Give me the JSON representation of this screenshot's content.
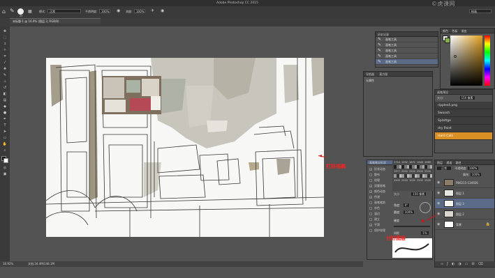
{
  "app": {
    "title": "Adobe Photoshop CC 2015",
    "watermark": "©虎课网"
  },
  "options_bar": {
    "brush_size": "25",
    "mode_label": "模式:",
    "mode_value": "正常",
    "opacity_label": "不透明度:",
    "opacity_value": "100%",
    "flow_label": "流量:",
    "flow_value": "100%",
    "workspace": "绘画"
  },
  "document": {
    "tab": "未标题-1 @ 16.9% (图层 3, RGB/8)"
  },
  "status": {
    "zoom": "16.92%",
    "doc_info": "文档:34.4M/148.1M"
  },
  "history_panel": {
    "title": "历史记录",
    "items": [
      "画笔工具",
      "画笔工具",
      "画笔工具",
      "画笔工具",
      "画笔工具"
    ]
  },
  "navigator_panel": {
    "tabs": [
      "导航器",
      "直方图"
    ],
    "label": "无属性"
  },
  "color_panel": {
    "tabs": [
      "颜色",
      "色板",
      "渐变"
    ]
  },
  "brush_presets_panel": {
    "title": "画笔预设",
    "size_label": "大小:",
    "size_value": "150 像素",
    "brushes": [
      "ripples4.png",
      "Swoosh",
      "Splattge",
      "dry Paint",
      "Hard Calli"
    ],
    "sizes": [
      "1714",
      "1592",
      "1671",
      "1946",
      "1969",
      "1977",
      "2000",
      "2500",
      "2500",
      "2500",
      "2500",
      "2500",
      "1000",
      "2500",
      "2500"
    ]
  },
  "brush_settings": {
    "title": "画笔笔尖形状",
    "items": [
      {
        "label": "形状动态",
        "checked": true
      },
      {
        "label": "散布",
        "checked": false
      },
      {
        "label": "纹理",
        "checked": false
      },
      {
        "label": "双重画笔",
        "checked": true
      },
      {
        "label": "颜色动态",
        "checked": true
      },
      {
        "label": "传递",
        "checked": true
      },
      {
        "label": "画笔笔势",
        "checked": false
      },
      {
        "label": "杂色",
        "checked": false
      },
      {
        "label": "湿边",
        "checked": false
      },
      {
        "label": "建立",
        "checked": false
      },
      {
        "label": "平滑",
        "checked": true
      },
      {
        "label": "保护纹理",
        "checked": false
      }
    ],
    "size_label": "大小",
    "size_value": "150 像素",
    "angle_label": "角度:",
    "angle_value": "0°",
    "roundness_label": "圆度:",
    "roundness_value": "100%",
    "hardness_label": "硬度",
    "spacing_label": "间距",
    "spacing_value": "1%"
  },
  "layers_panel": {
    "tabs": [
      "图层",
      "通道",
      "路径"
    ],
    "blend_mode": "正常",
    "opacity_label": "不透明度:",
    "opacity_value": "100%",
    "fill_label": "填充:",
    "fill_value": "100%",
    "layers": [
      {
        "name": "P80215-134926",
        "selected": false
      },
      {
        "name": "图层 1",
        "selected": false
      },
      {
        "name": "图层 3",
        "selected": true
      },
      {
        "name": "图层 2",
        "selected": false
      },
      {
        "name": "背景",
        "selected": false
      }
    ]
  },
  "annotations": {
    "line_draft": "打好线稿",
    "layering": "分好图层"
  }
}
